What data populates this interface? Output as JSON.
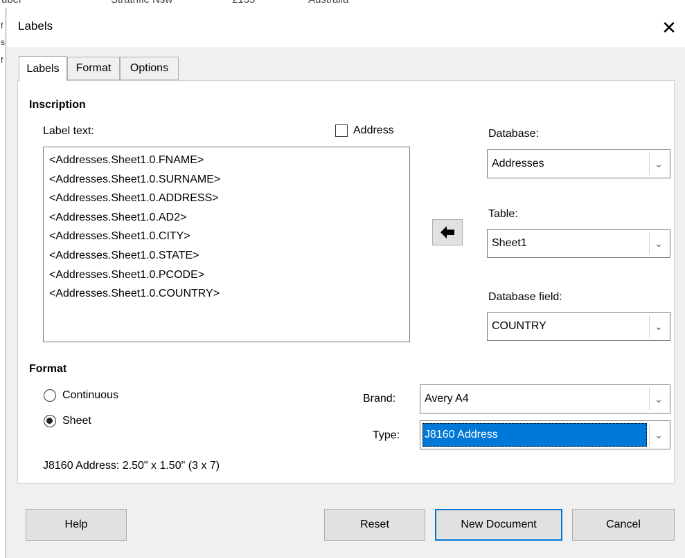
{
  "background_sheet": {
    "row_partial_text": [
      "uber",
      "Strathfie Nsw",
      "2135",
      "Australia"
    ],
    "left_edge_chars": [
      "f",
      "s",
      "f"
    ]
  },
  "dialog": {
    "title": "Labels",
    "close_glyph": "✕"
  },
  "tabs": [
    {
      "label": "Labels",
      "active": true
    },
    {
      "label": "Format",
      "active": false
    },
    {
      "label": "Options",
      "active": false
    }
  ],
  "inscription": {
    "heading": "Inscription",
    "label_text_caption": "Label text:",
    "address_checkbox": {
      "label": "Address",
      "checked": false
    },
    "lines": [
      "<Addresses.Sheet1.0.FNAME>",
      "<Addresses.Sheet1.0.SURNAME>",
      "<Addresses.Sheet1.0.ADDRESS>",
      "<Addresses.Sheet1.0.AD2>",
      "<Addresses.Sheet1.0.CITY>",
      "<Addresses.Sheet1.0.STATE>",
      "<Addresses.Sheet1.0.PCODE>",
      "<Addresses.Sheet1.0.COUNTRY>"
    ],
    "insert_arrow_icon": "left-arrow-icon"
  },
  "database": {
    "database_label": "Database:",
    "database_value": "Addresses",
    "table_label": "Table:",
    "table_value": "Sheet1",
    "field_label": "Database field:",
    "field_value": "COUNTRY"
  },
  "format": {
    "heading": "Format",
    "continuous_label": "Continuous",
    "sheet_label": "Sheet",
    "selected": "Sheet",
    "brand_label": "Brand:",
    "brand_value": "Avery A4",
    "type_label": "Type:",
    "type_value": "J8160 Address",
    "summary": "J8160 Address: 2.50\" x 1.50\" (3 x 7)"
  },
  "buttons": {
    "help": "Help",
    "reset": "Reset",
    "new_document": "New Document",
    "cancel": "Cancel"
  },
  "colors": {
    "selection": "#0078d7",
    "dialog_bg": "#f0f0f0",
    "panel_bg": "#ffffff"
  }
}
